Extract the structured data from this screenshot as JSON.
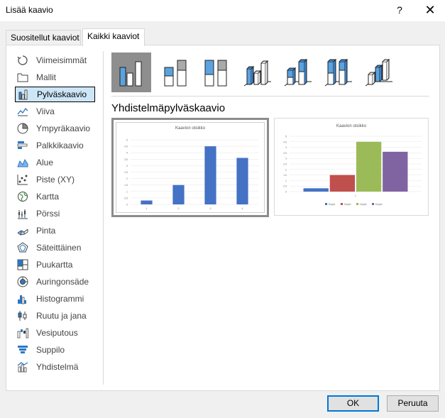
{
  "window": {
    "title": "Lisää kaavio",
    "help": "?",
    "close": "✕"
  },
  "tabs": [
    {
      "label": "Suositellut kaaviot"
    },
    {
      "label": "Kaikki kaaviot"
    }
  ],
  "sidebar": {
    "items": [
      {
        "label": "Viimeisimmät",
        "icon": "recent-icon"
      },
      {
        "label": "Mallit",
        "icon": "templates-folder-icon"
      },
      {
        "label": "Pylväskaavio",
        "icon": "column-chart-icon",
        "selected": true
      },
      {
        "label": "Viiva",
        "icon": "line-chart-icon"
      },
      {
        "label": "Ympyräkaavio",
        "icon": "pie-chart-icon"
      },
      {
        "label": "Palkkikaavio",
        "icon": "bar-chart-icon"
      },
      {
        "label": "Alue",
        "icon": "area-chart-icon"
      },
      {
        "label": "Piste (XY)",
        "icon": "scatter-chart-icon"
      },
      {
        "label": "Kartta",
        "icon": "map-chart-icon"
      },
      {
        "label": "Pörssi",
        "icon": "stock-chart-icon"
      },
      {
        "label": "Pinta",
        "icon": "surface-chart-icon"
      },
      {
        "label": "Säteittäinen",
        "icon": "radar-chart-icon"
      },
      {
        "label": "Puukartta",
        "icon": "treemap-chart-icon"
      },
      {
        "label": "Auringonsäde",
        "icon": "sunburst-chart-icon"
      },
      {
        "label": "Histogrammi",
        "icon": "histogram-chart-icon"
      },
      {
        "label": "Ruutu ja jana",
        "icon": "box-whisker-chart-icon"
      },
      {
        "label": "Vesiputous",
        "icon": "waterfall-chart-icon"
      },
      {
        "label": "Suppilo",
        "icon": "funnel-chart-icon"
      },
      {
        "label": "Yhdistelmä",
        "icon": "combo-chart-icon"
      }
    ]
  },
  "chart_types": [
    {
      "icon": "clustered-column-icon",
      "selected": true
    },
    {
      "icon": "stacked-column-icon"
    },
    {
      "icon": "100-stacked-column-icon"
    },
    {
      "icon": "3d-clustered-column-icon"
    },
    {
      "icon": "3d-stacked-column-icon"
    },
    {
      "icon": "3d-100-stacked-column-icon"
    },
    {
      "icon": "3d-column-icon"
    }
  ],
  "subtype_title": "Yhdistelmäpylväskaavio",
  "colors": {
    "accent": "#0078d7",
    "series1": "#4472c4",
    "series2": "#c0504d",
    "series3": "#9bbb59",
    "series4": "#8064a2"
  },
  "chart_data": [
    {
      "type": "bar",
      "title": "Kaavion otsikko",
      "categories": [
        "1",
        "2",
        "3",
        "4"
      ],
      "values": [
        0.3,
        1.5,
        4.5,
        3.6
      ],
      "yticks": [
        "0",
        "0.5",
        "1",
        "1.5",
        "2",
        "2.5",
        "3",
        "3.5",
        "4",
        "4.5",
        "5"
      ],
      "ylim": [
        0,
        5
      ]
    },
    {
      "type": "bar",
      "title": "Kaavion otsikko",
      "categories": [
        "1"
      ],
      "series": [
        {
          "name": "Sarja1",
          "values": [
            0.3
          ]
        },
        {
          "name": "Sarja2",
          "values": [
            1.5
          ]
        },
        {
          "name": "Sarja3",
          "values": [
            4.5
          ]
        },
        {
          "name": "Sarja4",
          "values": [
            3.6
          ]
        }
      ],
      "yticks": [
        "0",
        "0.5",
        "1",
        "1.5",
        "2",
        "2.5",
        "3",
        "3.5",
        "4",
        "4.5",
        "5"
      ],
      "ylim": [
        0,
        5
      ],
      "legend": "bottom"
    }
  ],
  "buttons": {
    "ok": "OK",
    "cancel": "Peruuta"
  }
}
